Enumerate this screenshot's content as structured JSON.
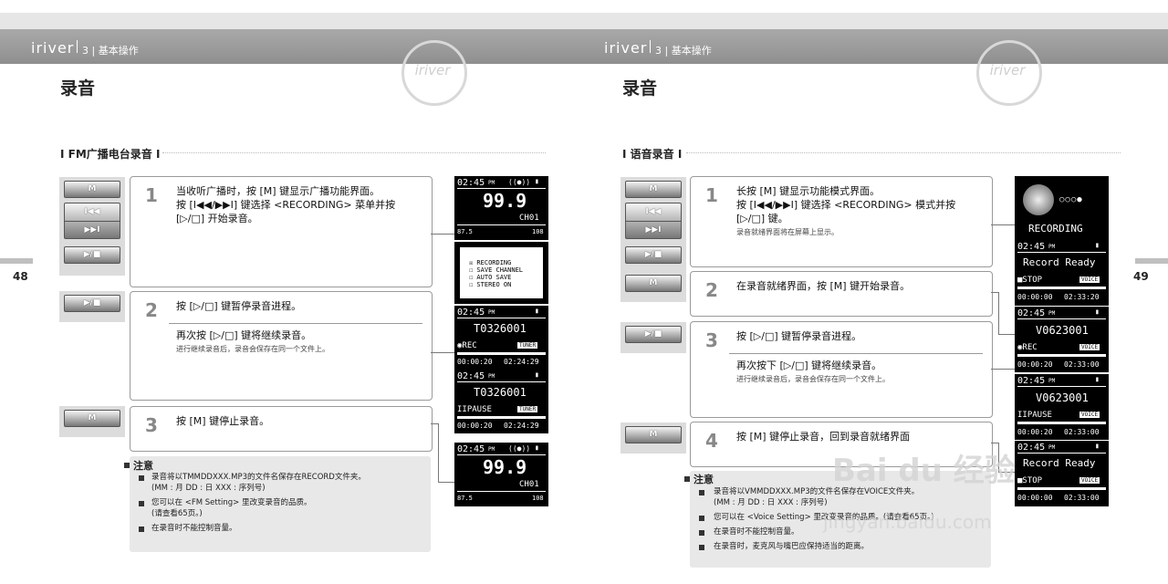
{
  "header": {
    "brand": "iriver",
    "section": "3 | 基本操作",
    "logo": "iriver"
  },
  "left": {
    "title": "录音",
    "subtitle": "I FM广播电台录音 I",
    "page_num": "48",
    "buttons": {
      "m": "M",
      "prev": "I◀◀",
      "next": "▶▶I",
      "play": "▶/■"
    },
    "steps": [
      {
        "num": "1",
        "lines": [
          "当收听广播时，按 [M] 键显示广播功能界面。",
          "按 [I◀◀/▶▶I] 键选择 <RECORDING> 菜单并按",
          "[▷/□] 开始录音。"
        ]
      },
      {
        "num": "2",
        "lines": [
          "按 [▷/□] 键暂停录音进程。"
        ],
        "extra": "再次按 [▷/□] 键将继续录音。",
        "extra_sub": "进行继续录音后，录音会保存在同一个文件上。"
      },
      {
        "num": "3",
        "lines": [
          "按 [M] 键停止录音。"
        ]
      }
    ],
    "note": {
      "title": "注意",
      "items": [
        "录音将以TMMDDXXX.MP3的文件名保存在RECORD文件夹。",
        "(MM : 月 DD : 日 XXX : 序列号)",
        "您可以在 <FM Setting> 里改变录音的品质。",
        "(请查看65页。)",
        "在录音时不能控制音量。"
      ]
    },
    "lcd": {
      "time": "02:45",
      "pm": "PM",
      "freq": "99.9",
      "ch": "CH01",
      "scale_lo": "87.5",
      "scale_hi": "108",
      "menu": [
        "☒ RECORDING",
        "☐ SAVE CHANNEL",
        "☐ AUTO SAVE",
        "☐ STEREO ON"
      ],
      "file": "T0326001",
      "rec": "◉REC",
      "pause": "IIPAUSE",
      "tuner": "TUNER",
      "elapsed": "00:00:20",
      "remain": "02:24:29"
    }
  },
  "right": {
    "title": "录音",
    "subtitle": "I 语音录音 I",
    "page_num": "49",
    "buttons": {
      "m": "M",
      "prev": "I◀◀",
      "next": "▶▶I",
      "play": "▶/■"
    },
    "steps": [
      {
        "num": "1",
        "lines": [
          "长按 [M] 键显示功能模式界面。",
          "按 [I◀◀/▶▶I] 键选择 <RECORDING> 模式并按",
          "[▷/□] 键。"
        ],
        "sub": "录音就绪界面将在屏幕上显示。"
      },
      {
        "num": "2",
        "lines": [
          "在录音就绪界面，按 [M] 键开始录音。"
        ]
      },
      {
        "num": "3",
        "lines": [
          "按 [▷/□] 键暂停录音进程。"
        ],
        "extra": "再次按下 [▷/□] 键将继续录音。",
        "extra_sub": "进行继续录音后，录音会保存在同一个文件上。"
      },
      {
        "num": "4",
        "lines": [
          "按 [M] 键停止录音，回到录音就绪界面"
        ]
      }
    ],
    "note": {
      "title": "注意",
      "items": [
        "录音将以VMMDDXXX.MP3的文件名保存在VOICE文件夹。",
        "(MM : 月 DD : 日 XXX : 序列号)",
        "您可以在 <Voice Setting> 里改变录音的品质。(请查看65页。)",
        "在录音时不能控制音量。",
        "在录音时，麦克风与嘴巴应保持适当的距离。"
      ]
    },
    "lcd": {
      "recording": "RECORDING",
      "time": "02:45",
      "pm": "PM",
      "ready": "Record Ready",
      "stop": "■STOP",
      "voice": "VOICE",
      "zero": "00:00:00",
      "remain": "02:33:20",
      "file": "V0623001",
      "rec": "◉REC",
      "pause": "IIPAUSE",
      "elapsed": "00:00:20",
      "remain2": "02:33:00"
    }
  },
  "watermark": {
    "main": "Bai du 经验",
    "url": "jingyan.baidu.com"
  }
}
